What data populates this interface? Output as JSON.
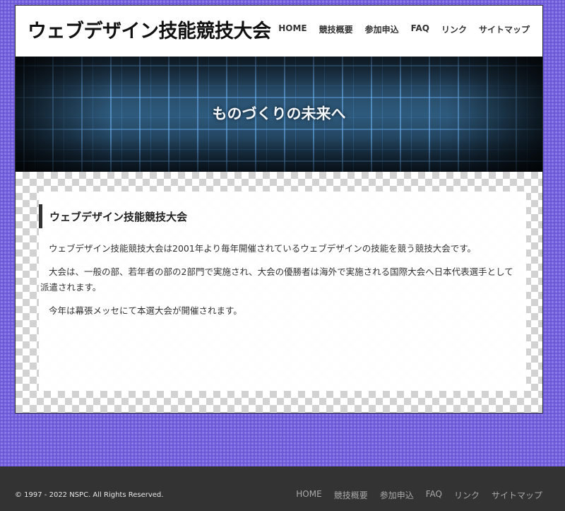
{
  "header": {
    "site_title": "ウェブデザイン技能競技大会",
    "nav": [
      {
        "label": "HOME"
      },
      {
        "label": "競技概要"
      },
      {
        "label": "参加申込"
      },
      {
        "label": "FAQ"
      },
      {
        "label": "リンク"
      },
      {
        "label": "サイトマップ"
      }
    ]
  },
  "hero": {
    "tagline": "ものづくりの未来へ"
  },
  "article": {
    "heading": "ウェブデザイン技能競技大会",
    "paragraphs": [
      "ウェブデザイン技能競技大会は2001年より毎年開催されているウェブデザインの技能を競う競技大会です。",
      "大会は、一般の部、若年者の部の2部門で実施され、大会の優勝者は海外で実施される国際大会へ日本代表選手として派遣されます。",
      "今年は幕張メッセにて本選大会が開催されます。"
    ]
  },
  "footer": {
    "copyright": "© 1997 - 2022 NSPC. All Rights Reserved.",
    "nav": [
      {
        "label": "HOME"
      },
      {
        "label": "競技概要"
      },
      {
        "label": "参加申込"
      },
      {
        "label": "FAQ"
      },
      {
        "label": "リンク"
      },
      {
        "label": "サイトマップ"
      }
    ]
  },
  "colors": {
    "background_purple": "#6a58d8",
    "footer_dark": "#333333",
    "heading_bar": "#333333"
  }
}
